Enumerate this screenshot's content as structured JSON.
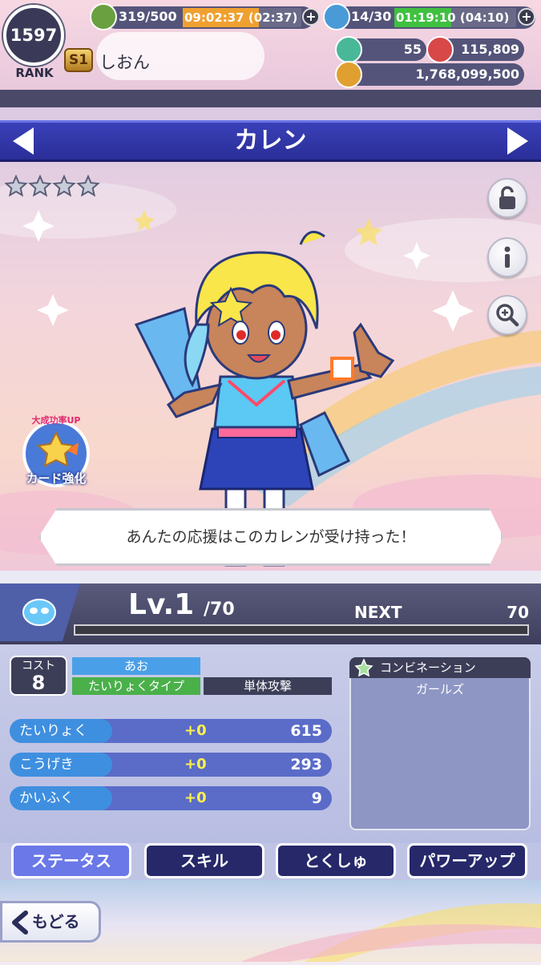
{
  "player": {
    "rank_number": "1597",
    "rank_label": "RANK",
    "title_badge": "S1",
    "name": "しおん"
  },
  "stamina": {
    "value": "319/500",
    "timer": "09:02:37 (02:37)",
    "fill": 0.64,
    "color": "#f0a030"
  },
  "magic": {
    "value": "14/30",
    "timer": "01:19:10 (04:10)",
    "fill": 0.47,
    "color": "#40c040"
  },
  "currency": {
    "stones": "55",
    "tickets": "115,809",
    "coins": "1,768,099,500"
  },
  "character": {
    "name": "カレン",
    "stars": 4,
    "quote": "あんたの応援はこのカレンが受け持った！"
  },
  "promo_badge": {
    "top": "大成功率UP",
    "bottom": "カード強化"
  },
  "level": {
    "prefix": "Lv.",
    "current": "1",
    "max": "/70",
    "next_label": "NEXT",
    "next_value": "70",
    "exp_fill": 0
  },
  "card": {
    "cost_label": "コスト",
    "cost_value": "8",
    "color": "あお",
    "type": "たいりょくタイプ",
    "attack": "単体攻撃"
  },
  "stats": [
    {
      "name": "たいりょく",
      "bonus": "+0",
      "value": "615"
    },
    {
      "name": "こうげき",
      "bonus": "+0",
      "value": "293"
    },
    {
      "name": "かいふく",
      "bonus": "+0",
      "value": "9"
    }
  ],
  "combination": {
    "title": "コンビネーション",
    "items": [
      "ガールズ"
    ]
  },
  "tabs": [
    "ステータス",
    "スキル",
    "とくしゅ",
    "パワーアップ"
  ],
  "back_label": "もどる",
  "colors": {
    "title_band": "#2a2e98",
    "tab_active": "#6a78e8",
    "tab_inactive": "#26286a",
    "stat_bonus": "#fff14a"
  }
}
